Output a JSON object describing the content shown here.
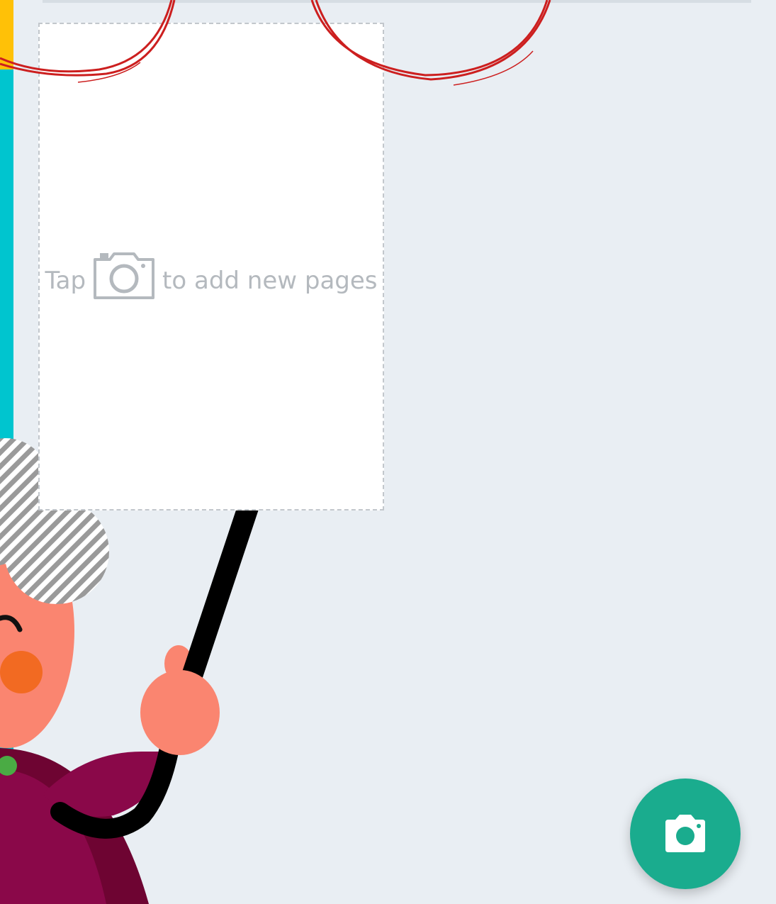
{
  "page": {
    "background": "#e9eef3"
  },
  "empty_state": {
    "prefix": "Tap",
    "suffix": "to add new pages",
    "icon": "camera-icon"
  },
  "fab": {
    "icon": "camera-icon",
    "color": "#1aac8e"
  },
  "colors": {
    "accent": "#1aac8e",
    "edge_teal": "#00c5cf",
    "edge_yellow": "#ffc107",
    "glasses_red": "#cc1f1f"
  }
}
